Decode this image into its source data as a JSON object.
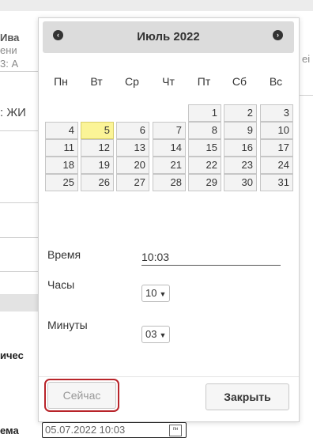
{
  "background": {
    "fragments": {
      "iva": "Ива",
      "eni": "ени",
      "three_a": "3: А",
      "ej": "ei",
      "zhi": ": ЖИ",
      "ches": "ичес",
      "ma": "ема"
    }
  },
  "calendar": {
    "month_title": "Июль 2022",
    "prev_icon": "chevron-left-circle-icon",
    "next_icon": "chevron-right-circle-icon",
    "weekdays": [
      "Пн",
      "Вт",
      "Ср",
      "Чт",
      "Пт",
      "Сб",
      "Вс"
    ],
    "weeks": [
      [
        "",
        "",
        "",
        "",
        "1",
        "2",
        "3"
      ],
      [
        "4",
        "5",
        "6",
        "7",
        "8",
        "9",
        "10"
      ],
      [
        "11",
        "12",
        "13",
        "14",
        "15",
        "16",
        "17"
      ],
      [
        "18",
        "19",
        "20",
        "21",
        "22",
        "23",
        "24"
      ],
      [
        "25",
        "26",
        "27",
        "28",
        "29",
        "30",
        "31"
      ]
    ],
    "today": "5",
    "today_color": "#fbf497"
  },
  "time": {
    "time_label": "Время",
    "time_value": "10:03",
    "hours_label": "Часы",
    "hours_value": "10",
    "minutes_label": "Минуты",
    "minutes_value": "03"
  },
  "buttons": {
    "now_label": "Сейчас",
    "close_label": "Закрыть",
    "highlight_color": "#b8242a"
  },
  "field": {
    "value": "05.07.2022 10:03",
    "icon_text": "пн",
    "icon": "calendar-icon"
  }
}
